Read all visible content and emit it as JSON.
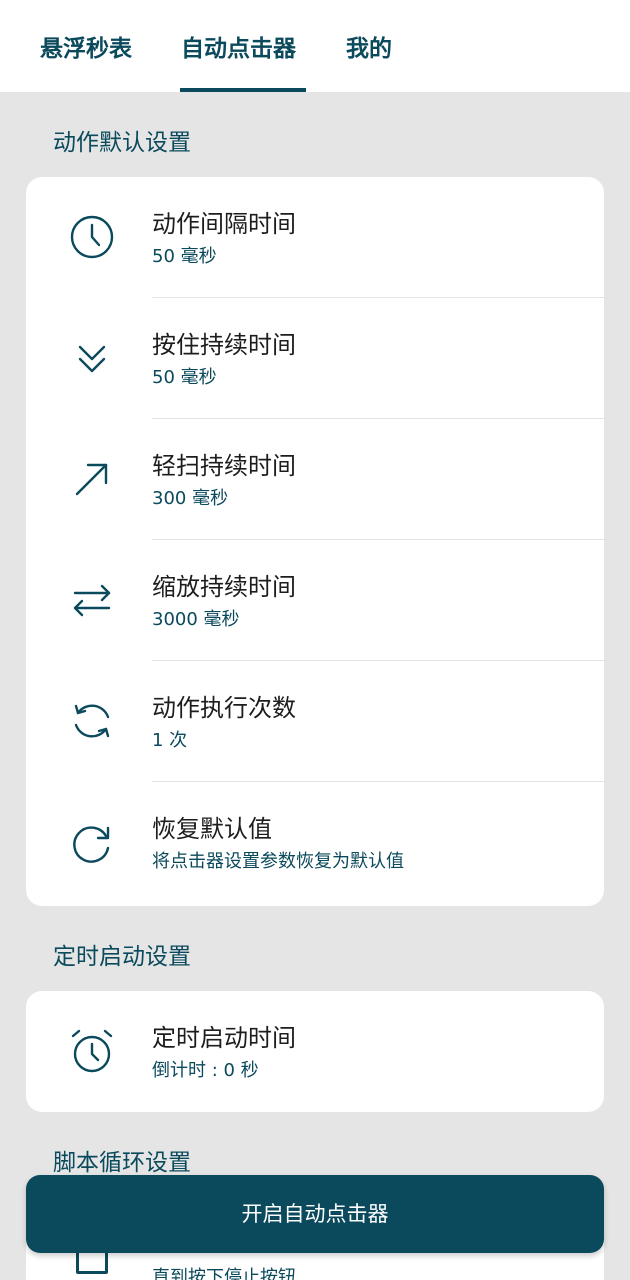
{
  "tabs": [
    {
      "label": "悬浮秒表"
    },
    {
      "label": "自动点击器",
      "selected": true
    },
    {
      "label": "我的"
    }
  ],
  "action_settings": {
    "title": "动作默认设置",
    "items": [
      {
        "title": "动作间隔时间",
        "subtitle": "50 毫秒",
        "icon": "clock-icon"
      },
      {
        "title": "按住持续时间",
        "subtitle": "50 毫秒",
        "icon": "double-chevron-down-icon"
      },
      {
        "title": "轻扫持续时间",
        "subtitle": "300 毫秒",
        "icon": "arrow-up-right-icon"
      },
      {
        "title": "缩放持续时间",
        "subtitle": "3000 毫秒",
        "icon": "swap-horizontal-icon"
      },
      {
        "title": "动作执行次数",
        "subtitle": "1 次",
        "icon": "sync-icon"
      },
      {
        "title": "恢复默认值",
        "subtitle": "将点击器设置参数恢复为默认值",
        "icon": "redo-circle-icon"
      }
    ]
  },
  "timer_settings": {
    "title": "定时启动设置",
    "items": [
      {
        "title": "定时启动时间",
        "subtitle": "倒计时 : 0 秒",
        "icon": "alarm-clock-icon"
      }
    ]
  },
  "loop_settings": {
    "title": "脚本循环设置",
    "partial_subtitle": "直到按下停止按钮"
  },
  "start_button": {
    "label": "开启自动点击器"
  },
  "colors": {
    "accent": "#0b4a5c",
    "background": "#e5e5e5",
    "card": "#ffffff",
    "text": "#1d1d1d"
  }
}
